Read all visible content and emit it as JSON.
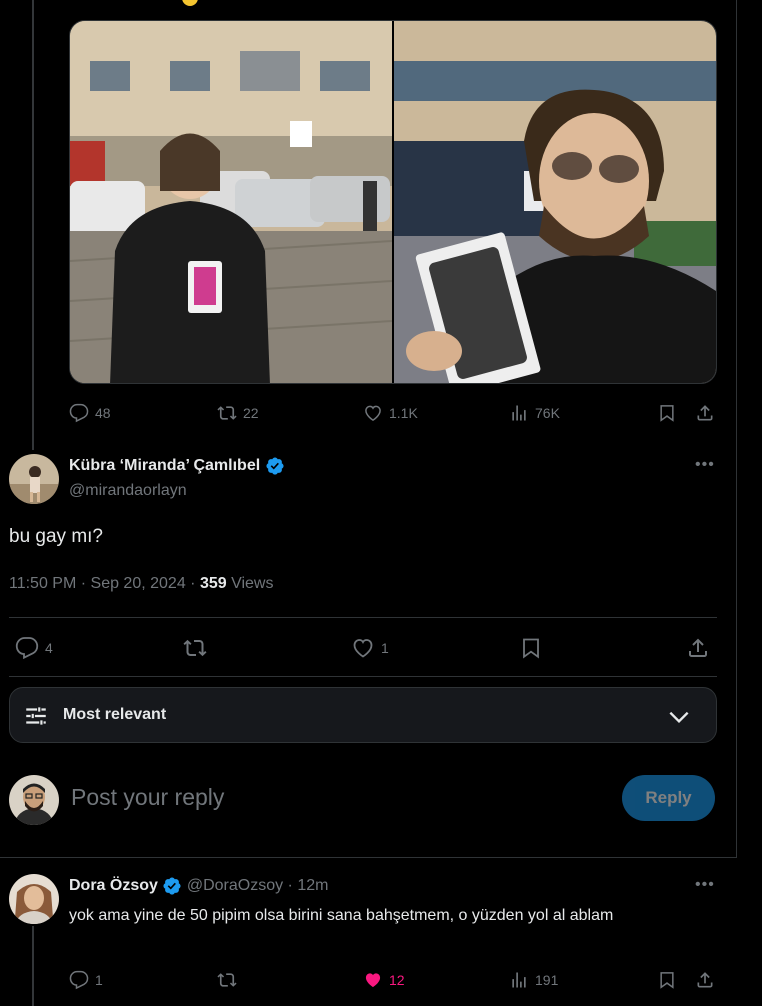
{
  "top_post": {
    "stats": {
      "replies": "48",
      "reposts": "22",
      "likes": "1.1K",
      "views": "76K"
    }
  },
  "main_post": {
    "author_name": "Kübra ‘Miranda’ Çamlıbel",
    "author_handle": "@mirandaorlayn",
    "text": "bu gay mı?",
    "timestamp": "11:50 PM · Sep 20, 2024 · ",
    "views_count": "359",
    "views_label": " Views",
    "stats": {
      "replies": "4",
      "reposts": "",
      "likes": "1"
    }
  },
  "sort": {
    "label": "Most relevant"
  },
  "composer": {
    "placeholder": "Post your reply",
    "button_label": "Reply"
  },
  "reply": {
    "author_name": "Dora Özsoy",
    "author_handle": "@DoraOzsoy",
    "time": " · 12m",
    "text": "yok ama yine de 50 pipim olsa birini sana bahşetmem, o yüzden yol al ablam",
    "stats": {
      "replies": "1",
      "likes": "12",
      "views": "191"
    }
  },
  "colors": {
    "accent": "#1d9bf0",
    "like_active": "#f91880",
    "muted": "#71767b"
  }
}
